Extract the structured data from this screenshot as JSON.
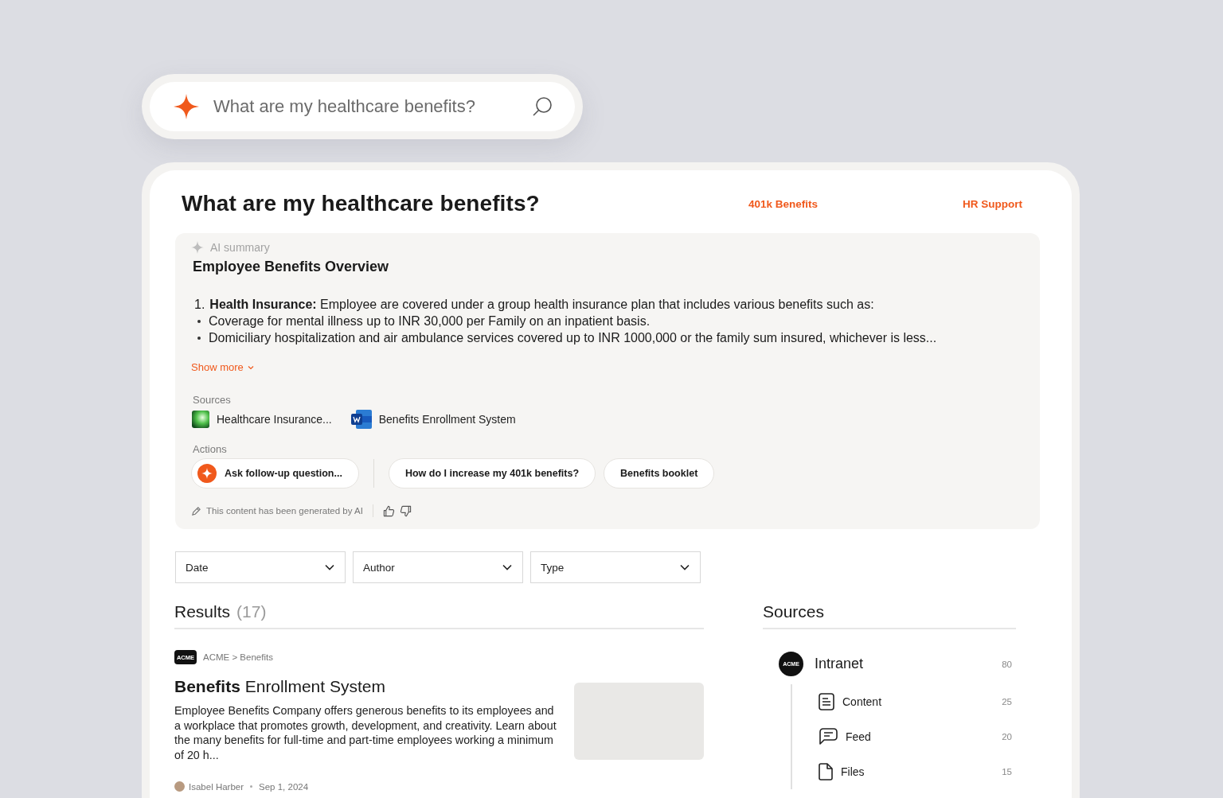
{
  "search": {
    "value": "What are my healthcare benefits?"
  },
  "header": {
    "title": "What are my healthcare benefits?",
    "links": [
      "401k Benefits",
      "HR Support"
    ]
  },
  "ai_summary": {
    "label": "AI summary",
    "title": "Employee Benefits Overview",
    "items": [
      {
        "number": "1.",
        "text": "**Health Insurance:** Employee are covered under a group health insurance plan that includes various benefits such as:"
      }
    ],
    "bullets": [
      "Coverage for mental illness up to INR 30,000 per Family on an inpatient basis.",
      "Domiciliary hospitalization and air ambulance services covered up to INR 1000,000 or the family sum insured, whichever is less..."
    ],
    "show_more": "Show more",
    "sources_label": "Sources",
    "sources": [
      {
        "kind": "image",
        "title": "Healthcare Insurance..."
      },
      {
        "kind": "word",
        "title": "Benefits Enrollment System"
      }
    ],
    "actions_label": "Actions",
    "actions": [
      {
        "kind": "ask",
        "label": "Ask follow-up question..."
      },
      {
        "kind": "suggestion",
        "label": "How do I increase my 401k benefits?"
      },
      {
        "kind": "suggestion",
        "label": "Benefits booklet"
      }
    ],
    "disclaimer": "This content has been generated by AI"
  },
  "filters": [
    {
      "label": "Date"
    },
    {
      "label": "Author"
    },
    {
      "label": "Type"
    }
  ],
  "results": {
    "title": "Results",
    "count": "(17)",
    "items": [
      {
        "logo": "ACME",
        "breadcrumb": "ACME > Benefits",
        "title": "**Benefits** Enrollment System",
        "description": "Employee Benefits Company offers generous benefits to its employees and a workplace that promotes growth, development, and creativity. Learn about the many benefits for full-time and part-time employees working a minimum of 20 h...",
        "author": "Isabel Harber",
        "date": "Sep 1, 2024"
      }
    ]
  },
  "sources_panel": {
    "title": "Sources",
    "groups": [
      {
        "logo": "ACME",
        "name": "Intranet",
        "count": "80",
        "children": [
          {
            "kind": "content",
            "name": "Content",
            "count": "25"
          },
          {
            "kind": "feed",
            "name": "Feed",
            "count": "20"
          },
          {
            "kind": "files",
            "name": "Files",
            "count": "15"
          }
        ]
      }
    ]
  }
}
